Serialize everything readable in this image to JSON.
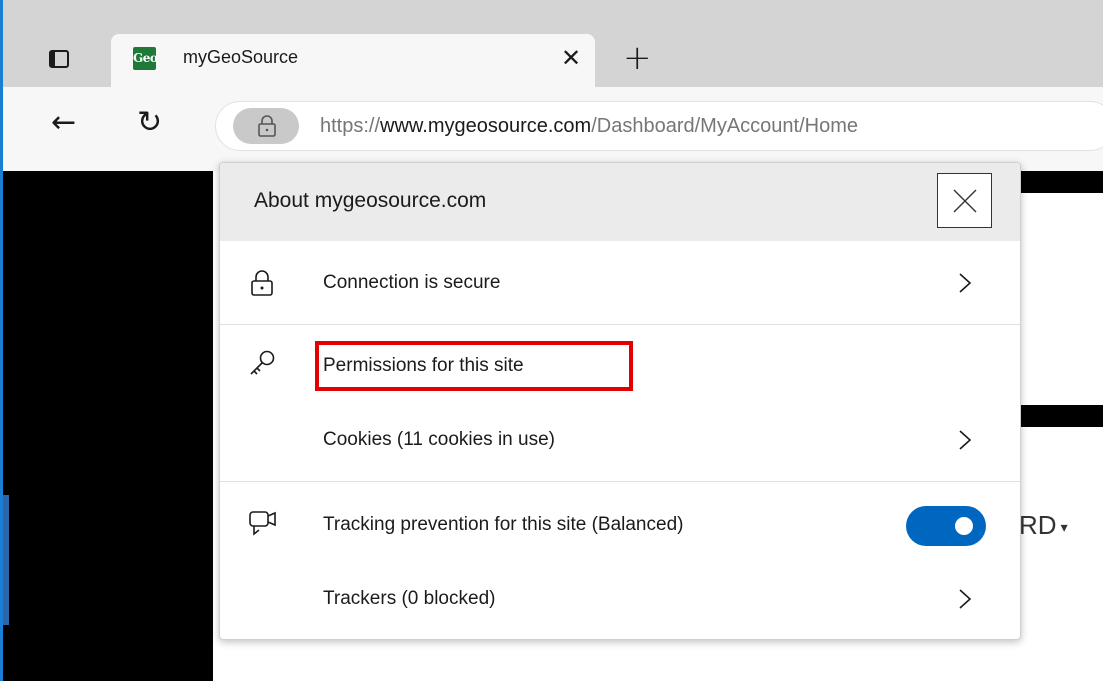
{
  "browser": {
    "tab": {
      "favicon_text": "Geo",
      "title": "myGeoSource",
      "close_glyph": "✕"
    },
    "new_tab_glyph": "+",
    "back_glyph": "←",
    "reload_glyph": "↻",
    "address": {
      "scheme": "https://",
      "host": "www.mygeosource.com",
      "path": "/Dashboard/MyAccount/Home"
    }
  },
  "page": {
    "menu_text": "RD",
    "menu_caret": "▾"
  },
  "flyout": {
    "title": "About mygeosource.com",
    "rows": {
      "connection": "Connection is secure",
      "permissions": "Permissions for this site",
      "cookies": "Cookies (11 cookies in use)",
      "tracking": "Tracking prevention for this site (Balanced)",
      "trackers": "Trackers (0 blocked)"
    },
    "tracking_toggle_on": true
  },
  "colors": {
    "toggle_on": "#0067c0",
    "highlight": "#e30000",
    "favicon": "#1f7a3a"
  },
  "icons": [
    "tab-actions-icon",
    "lock-icon",
    "key-icon",
    "tracking-icon",
    "chevron-right-icon",
    "close-icon"
  ]
}
